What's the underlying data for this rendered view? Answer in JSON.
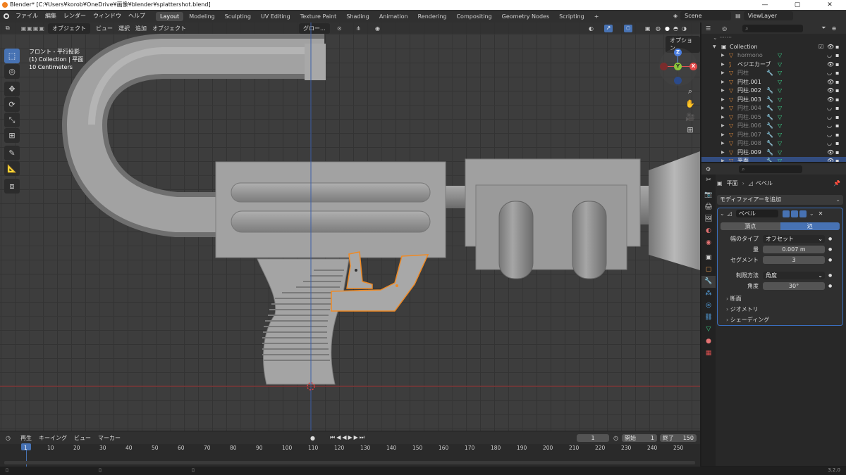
{
  "window": {
    "title": "Blender* [C:¥Users¥korob¥OneDrive¥画像¥blender¥splattershot.blend]",
    "min": "—",
    "max": "▢",
    "close": "✕"
  },
  "menu": [
    "ファイル",
    "編集",
    "レンダー",
    "ウィンドウ",
    "ヘルプ"
  ],
  "workspaces": [
    "Layout",
    "Modeling",
    "Sculpting",
    "UV Editing",
    "Texture Paint",
    "Shading",
    "Animation",
    "Rendering",
    "Compositing",
    "Geometry Nodes",
    "Scripting"
  ],
  "active_workspace": "Layout",
  "add_workspace": "+",
  "scene": "Scene",
  "view_layer": "ViewLayer",
  "viewport": {
    "mode": "オブジェクト",
    "menus": [
      "ビュー",
      "選択",
      "追加",
      "オブジェクト"
    ],
    "transform_orientation": "グロー...",
    "options": "オプション",
    "view_name": "フロント - 平行投影",
    "collection_info": "(1) Collection | 平面",
    "scale_info": "10 Centimeters",
    "gizmo": {
      "z": "Z",
      "x": "X",
      "y": "Y"
    }
  },
  "outliner": {
    "collection": "Collection",
    "rows": [
      {
        "name": "hormono",
        "dim": true,
        "icon": "mesh",
        "mod": false
      },
      {
        "name": "ベジエカーブ",
        "dim": false,
        "icon": "curve",
        "mod": false
      },
      {
        "name": "円柱",
        "dim": true,
        "icon": "mesh",
        "mod": true
      },
      {
        "name": "円柱.001",
        "dim": false,
        "icon": "mesh",
        "mod": false
      },
      {
        "name": "円柱.002",
        "dim": false,
        "icon": "mesh",
        "mod": true
      },
      {
        "name": "円柱.003",
        "dim": false,
        "icon": "mesh",
        "mod": true
      },
      {
        "name": "円柱.004",
        "dim": true,
        "icon": "mesh",
        "mod": true
      },
      {
        "name": "円柱.005",
        "dim": true,
        "icon": "mesh",
        "mod": true
      },
      {
        "name": "円柱.006",
        "dim": true,
        "icon": "mesh",
        "mod": true
      },
      {
        "name": "円柱.007",
        "dim": true,
        "icon": "mesh",
        "mod": true
      },
      {
        "name": "円柱.008",
        "dim": true,
        "icon": "mesh",
        "mod": true
      },
      {
        "name": "円柱.009",
        "dim": false,
        "icon": "mesh",
        "mod": true
      },
      {
        "name": "平面",
        "dim": false,
        "icon": "mesh",
        "mod": true,
        "selected": true
      }
    ]
  },
  "properties": {
    "breadcrumb_object": "平面",
    "breadcrumb_modifier": "ベベル",
    "add_modifier": "モディファイアーを追加",
    "modifier_name": "ベベル",
    "affect_vertices": "頂点",
    "affect_edges": "辺",
    "width_type_label": "幅のタイプ",
    "width_type_value": "オフセット",
    "amount_label": "量",
    "amount_value": "0.007 m",
    "segments_label": "セグメント",
    "segments_value": "3",
    "limit_method_label": "制限方法",
    "limit_method_value": "角度",
    "angle_label": "角度",
    "angle_value": "30°",
    "profile": "断面",
    "geometry": "ジオメトリ",
    "shading": "シェーディング"
  },
  "timeline": {
    "menus": [
      "再生",
      "キーイング",
      "ビュー",
      "マーカー"
    ],
    "current_frame": "1",
    "start_label": "開始",
    "start_value": "1",
    "end_label": "終了",
    "end_value": "150",
    "frames": [
      "1",
      "10",
      "20",
      "30",
      "40",
      "50",
      "60",
      "70",
      "80",
      "90",
      "100",
      "110",
      "120",
      "130",
      "140",
      "150",
      "160",
      "170",
      "180",
      "190",
      "200",
      "210",
      "220",
      "230",
      "240",
      "250"
    ]
  },
  "status": {
    "version": "3.2.0"
  },
  "colors": {
    "accent": "#4772b3",
    "selected_orange": "#f08a24",
    "header": "#303030",
    "viewport_bg": "#3d3d3d"
  }
}
